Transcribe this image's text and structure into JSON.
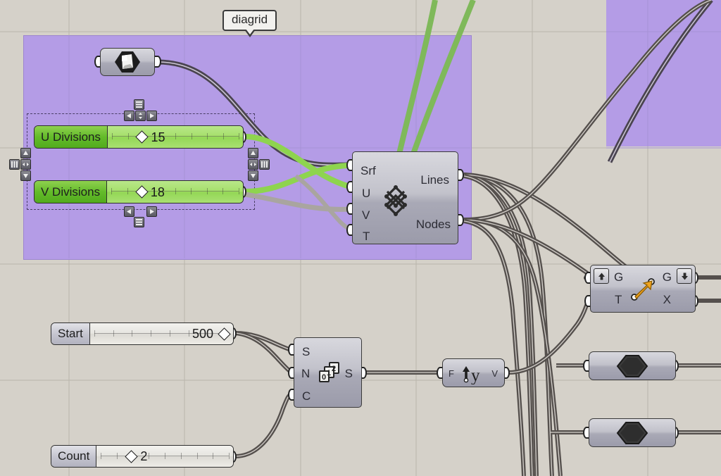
{
  "app": {
    "name": "Grasshopper Canvas",
    "canvas_background": "#d5d1c9",
    "grid_line_color": "#b9b5ac",
    "group_color": "#b49ce6",
    "wire_color_default": "#4a4450",
    "wire_color_number": "#8ed44f",
    "wire_color_light": "#a9a5a0"
  },
  "group_label": {
    "text": "diagrid",
    "name": "group-label-diagrid"
  },
  "sliders": [
    {
      "id": "u-divisions",
      "label": "U Divisions",
      "value": "15",
      "handle_percent": 22,
      "style": "green",
      "tick_count": 9
    },
    {
      "id": "v-divisions",
      "label": "V Divisions",
      "value": "18",
      "handle_percent": 22,
      "style": "green",
      "tick_count": 9
    },
    {
      "id": "start",
      "label": "Start",
      "value": "500",
      "handle_percent": 96,
      "style": "gray",
      "tick_count": 8
    },
    {
      "id": "count",
      "label": "Count",
      "value": "2",
      "handle_percent": 22,
      "style": "gray",
      "tick_count": 9
    }
  ],
  "components": {
    "surface_param": {
      "name": "surface-parameter",
      "icon": "surface-icon"
    },
    "diagrid": {
      "name": "diagrid-component",
      "icon": "diagrid-lattice-icon",
      "inputs": [
        "Srf",
        "U",
        "V",
        "T"
      ],
      "outputs": [
        "Lines",
        "Nodes"
      ]
    },
    "series": {
      "name": "series-component",
      "icon": "series-numbers-icon",
      "inputs": [
        "S",
        "N",
        "C"
      ],
      "outputs": [
        "S"
      ]
    },
    "unit_y": {
      "name": "unit-y-component",
      "icon": "unit-y-arrow-icon",
      "inputs": [
        "F"
      ],
      "outputs": [
        "V"
      ],
      "glyph": "y"
    },
    "move": {
      "name": "move-component",
      "icon": "move-arrow-icon",
      "inputs": [
        "G",
        "T"
      ],
      "outputs": [
        "G",
        "X"
      ],
      "corner_up": "up-arrow-icon",
      "corner_down": "down-arrow-icon"
    },
    "brep_param_1": {
      "name": "brep-parameter-one",
      "icon": "brep-hexagon-icon"
    },
    "brep_param_2": {
      "name": "brep-parameter-two",
      "icon": "brep-hexagon-icon"
    }
  },
  "grips": {
    "align_label": "align-grip",
    "arrow_up": "arrow-up-grip-icon",
    "arrow_down": "arrow-down-grip-icon",
    "arrow_left": "arrow-left-grip-icon",
    "arrow_right": "arrow-right-grip-icon",
    "arrow_updown": "arrow-updown-grip-icon",
    "arrow_leftright": "arrow-leftright-grip-icon",
    "rows": "rows-grip-icon",
    "columns": "columns-grip-icon"
  }
}
